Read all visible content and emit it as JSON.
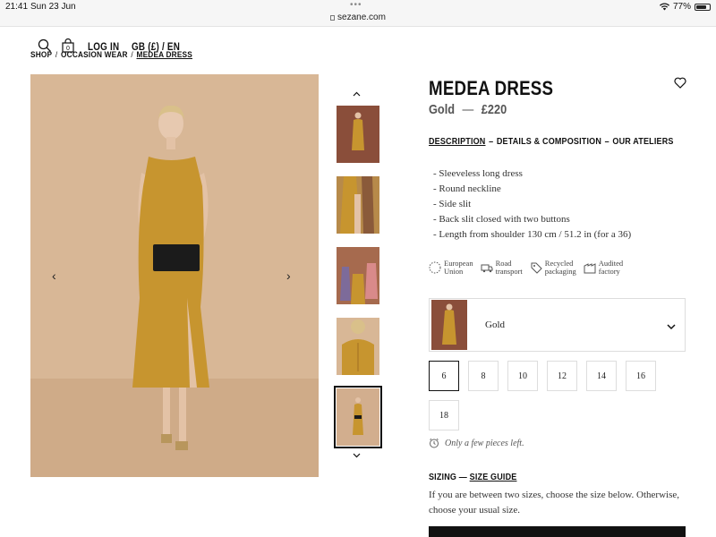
{
  "status_bar": {
    "time": "21:41",
    "date": "Sun 23 Jun",
    "url": "sezane.com",
    "battery": "77%",
    "battery_level": 0.77
  },
  "nav": {
    "login": "LOG IN",
    "locale": "GB (£) / EN",
    "bag_count": "0"
  },
  "breadcrumb": {
    "items": [
      "SHOP",
      "OCCASION WEAR",
      "MEDEA DRESS"
    ],
    "separator": "/"
  },
  "gallery": {
    "thumbnail_count": 5,
    "active_thumbnail": 5
  },
  "product": {
    "title": "MEDEA DRESS",
    "color": "Gold",
    "price_separator": "—",
    "price": "£220"
  },
  "tabs": {
    "description": "DESCRIPTION",
    "details": "DETAILS & COMPOSITION",
    "ateliers": "OUR ATELIERS",
    "separator": "–"
  },
  "description": [
    "- Sleeveless long dress",
    "- Round neckline",
    "- Side slit",
    "- Back slit closed with two buttons",
    "- Length from shoulder 130 cm / 51.2 in (for a 36)"
  ],
  "badges": [
    {
      "line1": "European",
      "line2": "Union",
      "icon": "eu-stars-icon"
    },
    {
      "line1": "Road",
      "line2": "transport",
      "icon": "truck-icon"
    },
    {
      "line1": "Recycled",
      "line2": "packaging",
      "icon": "tag-icon"
    },
    {
      "line1": "Audited",
      "line2": "factory",
      "icon": "factory-icon"
    }
  ],
  "color_select": {
    "value": "Gold",
    "swatch": "#c9974c"
  },
  "sizes": [
    {
      "label": "6",
      "selected": true
    },
    {
      "label": "8",
      "selected": false
    },
    {
      "label": "10",
      "selected": false
    },
    {
      "label": "12",
      "selected": false
    },
    {
      "label": "14",
      "selected": false
    },
    {
      "label": "16",
      "selected": false
    },
    {
      "label": "18",
      "selected": false
    }
  ],
  "stock_message": "Only a few pieces left.",
  "sizing": {
    "label": "SIZING",
    "separator": "—",
    "guide": "SIZE GUIDE",
    "text": "If you are between two sizes, choose the size below. Otherwise, choose your usual size."
  },
  "colors": {
    "dress": "#c7952f",
    "background": "#d9b89a",
    "accent": "#111111"
  }
}
